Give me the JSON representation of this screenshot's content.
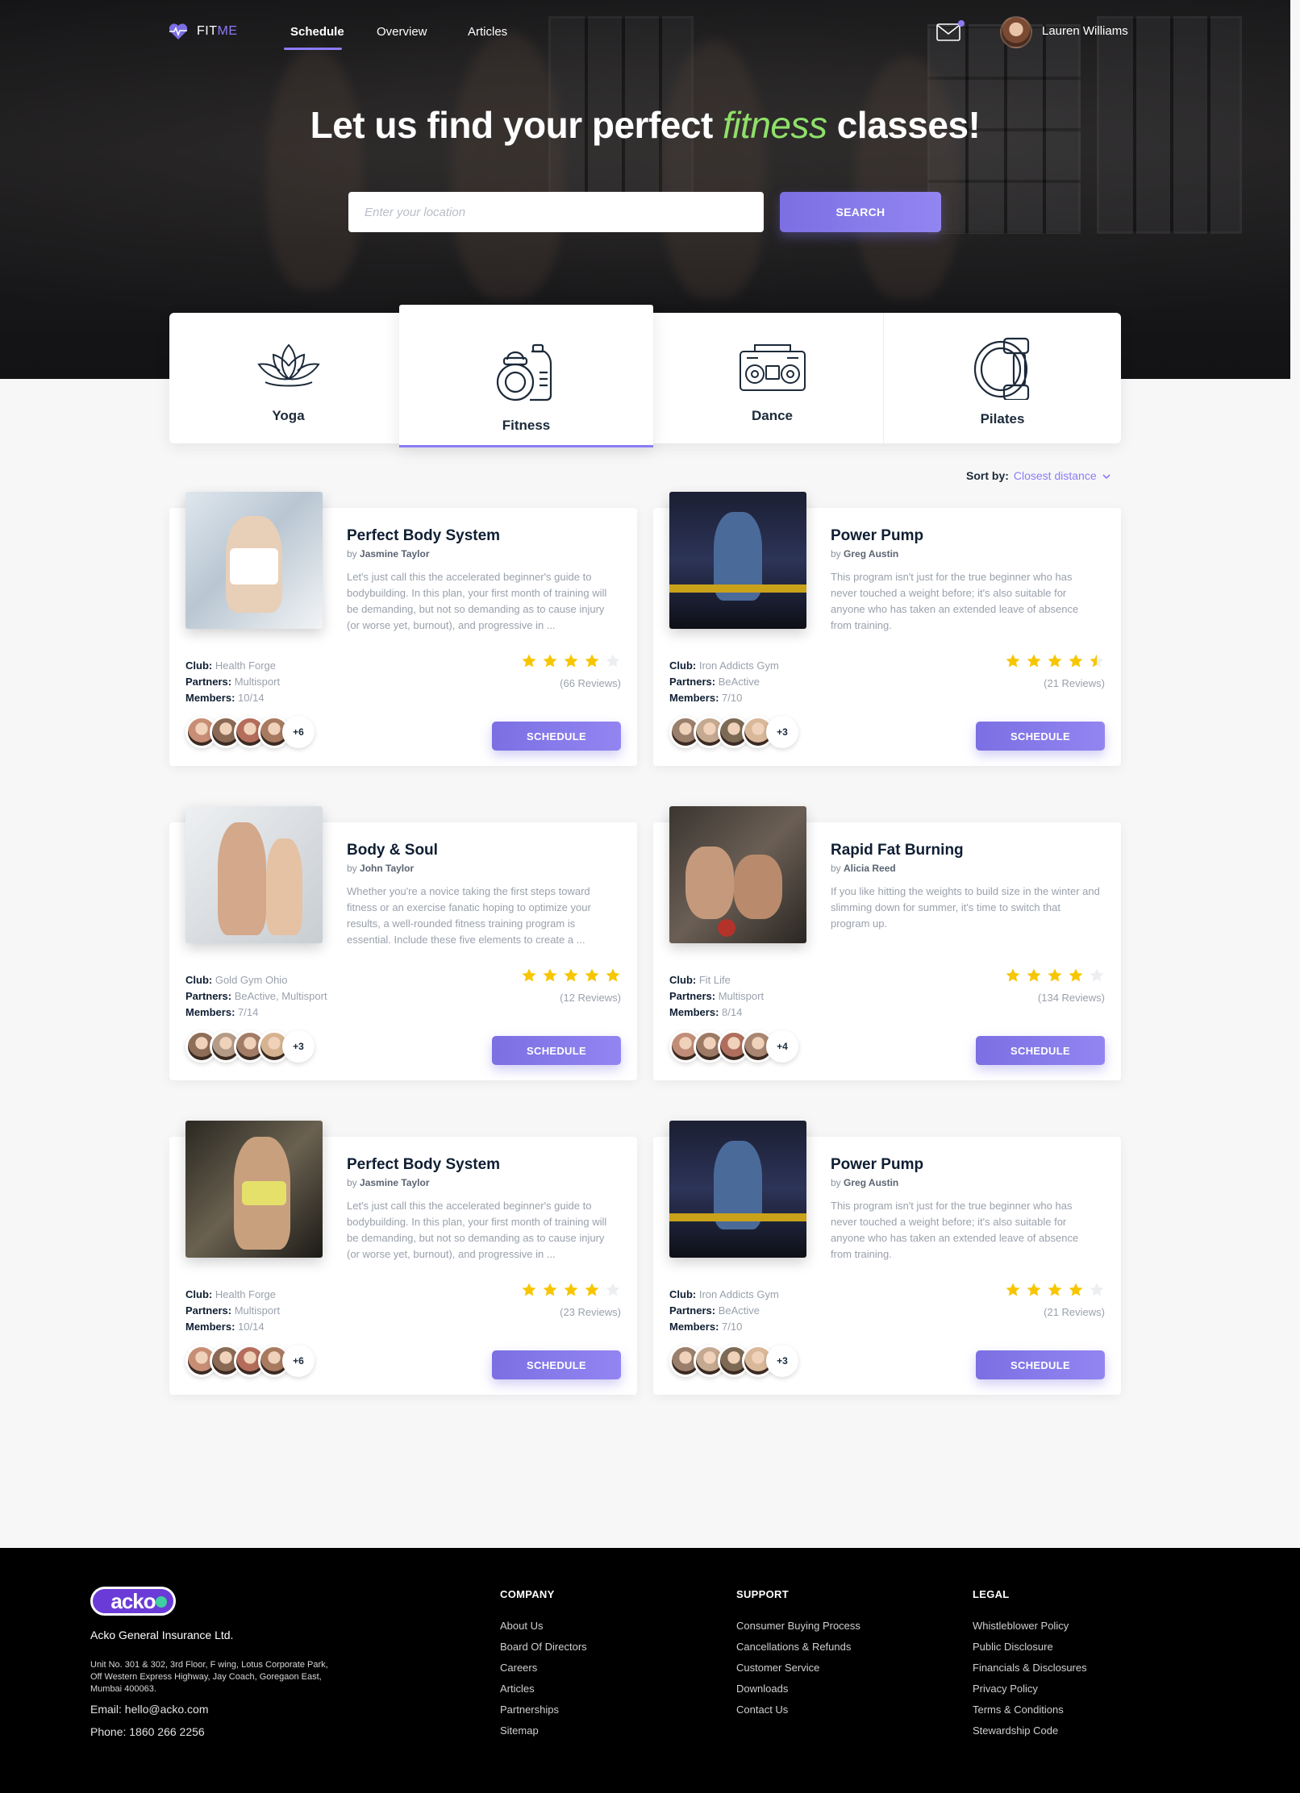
{
  "nav": {
    "logo_main": "FIT",
    "logo_accent": "ME",
    "links": [
      "Schedule",
      "Overview",
      "Articles"
    ],
    "user_name": "Lauren Williams"
  },
  "hero": {
    "title_before": "Let us find your perfect ",
    "title_accent": "fitness",
    "title_after": " classes!",
    "search_placeholder": "Enter your location",
    "search_button": "SEARCH"
  },
  "categories": [
    "Yoga",
    "Fitness",
    "Dance",
    "Pilates"
  ],
  "active_category": "Fitness",
  "sort": {
    "label": "Sort by:",
    "value": "Closest distance"
  },
  "labels": {
    "club": "Club:",
    "partners": "Partners:",
    "members": "Members:",
    "schedule": "SCHEDULE",
    "by": "by "
  },
  "cards": [
    {
      "title": "Perfect Body System",
      "author": "Jasmine Taylor",
      "desc": "Let's just call this the accelerated beginner's guide to bodybuilding. In this plan, your first month of training will be demanding, but not so demanding as to cause injury (or worse yet, burnout), and progressive in ...",
      "club": "Health Forge",
      "partners": "Multisport",
      "members": "10/14",
      "rating": 4,
      "reviews": "(66 Reviews)",
      "more": "+6"
    },
    {
      "title": "Power Pump",
      "author": "Greg Austin",
      "desc": "This program isn't just for the true beginner who has never touched a weight before; it's also suitable for anyone who has taken an extended leave of absence from training.",
      "club": "Iron Addicts Gym",
      "partners": "BeActive",
      "members": "7/10",
      "rating": 4.5,
      "reviews": "(21 Reviews)",
      "more": "+3"
    },
    {
      "title": "Body & Soul",
      "author": "John Taylor",
      "desc": "Whether you're a novice taking the first steps toward fitness or an exercise fanatic hoping to optimize your results, a well-rounded fitness training program is essential. Include these five elements to create a ...",
      "club": "Gold Gym Ohio",
      "partners": "BeActive, Multisport",
      "members": "7/14",
      "rating": 5,
      "reviews": "(12 Reviews)",
      "more": "+3"
    },
    {
      "title": "Rapid Fat Burning",
      "author": "Alicia Reed",
      "desc": "If you like hitting the weights to build size in the winter and slimming down for summer, it's time to switch that program up.",
      "club": "Fit Life",
      "partners": "Multisport",
      "members": "8/14",
      "rating": 4,
      "reviews": "(134 Reviews)",
      "more": "+4"
    },
    {
      "title": "Perfect Body System",
      "author": "Jasmine Taylor",
      "desc": "Let's just call this the accelerated beginner's guide to bodybuilding. In this plan, your first month of training will be demanding, but not so demanding as to cause injury (or worse yet, burnout), and progressive in ...",
      "club": "Health Forge",
      "partners": "Multisport",
      "members": "10/14",
      "rating": 4,
      "reviews": "(23 Reviews)",
      "more": "+6"
    },
    {
      "title": "Power Pump",
      "author": "Greg Austin",
      "desc": "This program isn't just for the true beginner who has never touched a weight before; it's also suitable for anyone who has taken an extended leave of absence from training.",
      "club": "Iron Addicts Gym",
      "partners": "BeActive",
      "members": "7/10",
      "rating": 4,
      "reviews": "(21 Reviews)",
      "more": "+3"
    }
  ],
  "footer": {
    "logo": "acko",
    "company": "Acko General Insurance Ltd.",
    "address": "Unit No. 301 & 302, 3rd Floor, F wing, Lotus Corporate Park, Off Western Express Highway, Jay Coach, Goregaon East, Mumbai 400063.",
    "email": "Email: hello@acko.com",
    "phone": "Phone: 1860 266 2256",
    "columns": [
      {
        "title": "COMPANY",
        "links": [
          "About Us",
          "Board Of Directors",
          "Careers",
          "Articles",
          "Partnerships",
          "Sitemap"
        ]
      },
      {
        "title": "SUPPORT",
        "links": [
          "Consumer Buying Process",
          "Cancellations & Refunds",
          "Customer Service",
          "Downloads",
          "Contact Us"
        ]
      },
      {
        "title": "LEGAL",
        "links": [
          "Whistleblower Policy",
          "Public Disclosure",
          "Financials & Disclosures",
          "Privacy Policy",
          "Terms & Conditions",
          "Stewardship Code"
        ]
      }
    ]
  },
  "colors": {
    "accent": "#8b7cf6",
    "highlight": "#8fe06a",
    "star": "#f7c600",
    "star_empty": "#eceef1"
  }
}
